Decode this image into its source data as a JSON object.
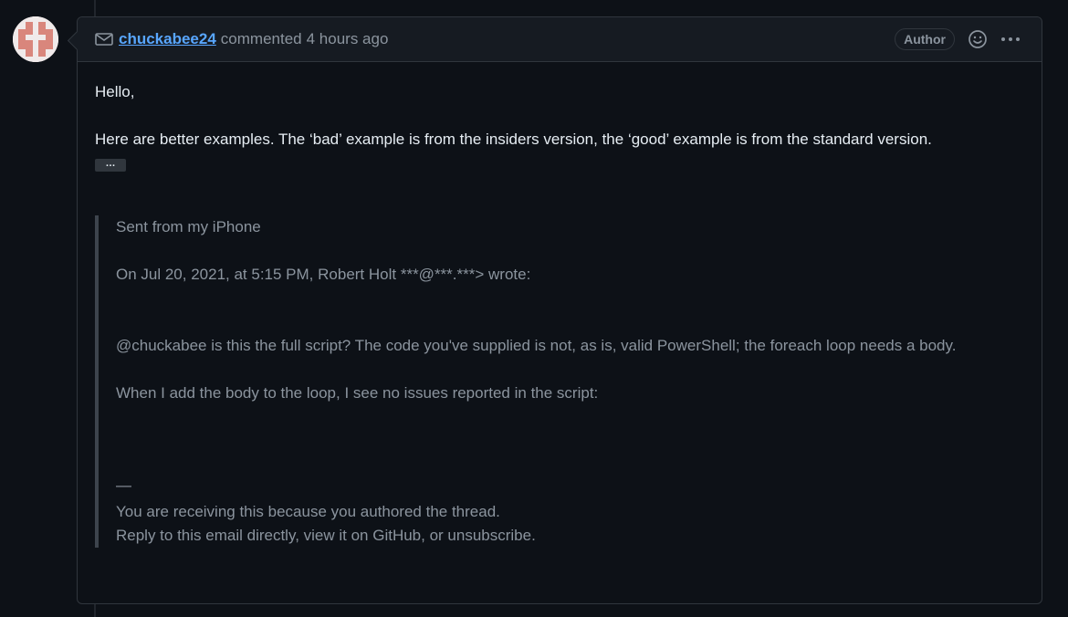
{
  "comment": {
    "author": "chuckabee24",
    "action": "commented",
    "time": "4 hours ago",
    "badge": "Author",
    "icons": {
      "mail": "mail-icon",
      "reaction": "smiley-icon",
      "menu": "kebab-icon"
    },
    "greeting": "Hello,",
    "paragraph": "Here are better examples. The ‘bad’ example is from the insiders version, the ‘good’ example is from the standard version.",
    "expand_label": "…",
    "quote": {
      "sent_from": "Sent from my iPhone",
      "on_date": "On Jul 20, 2021, at 5:15 PM, Robert Holt ***@***.***> wrote:",
      "question": "@chuckabee is this the full script? The code you've supplied is not, as is, valid PowerShell; the foreach loop needs a body.",
      "followup": "When I add the body to the loop, I see no issues reported in the script:",
      "separator": "—",
      "receiving": "You are receiving this because you authored the thread.",
      "reply": "Reply to this email directly, view it on GitHub, or unsubscribe."
    }
  },
  "colors": {
    "background": "#0d1117",
    "header_bg": "#161b22",
    "border": "#30363d",
    "link": "#58a6ff",
    "text": "#e6edf3",
    "muted": "#8b949e"
  }
}
